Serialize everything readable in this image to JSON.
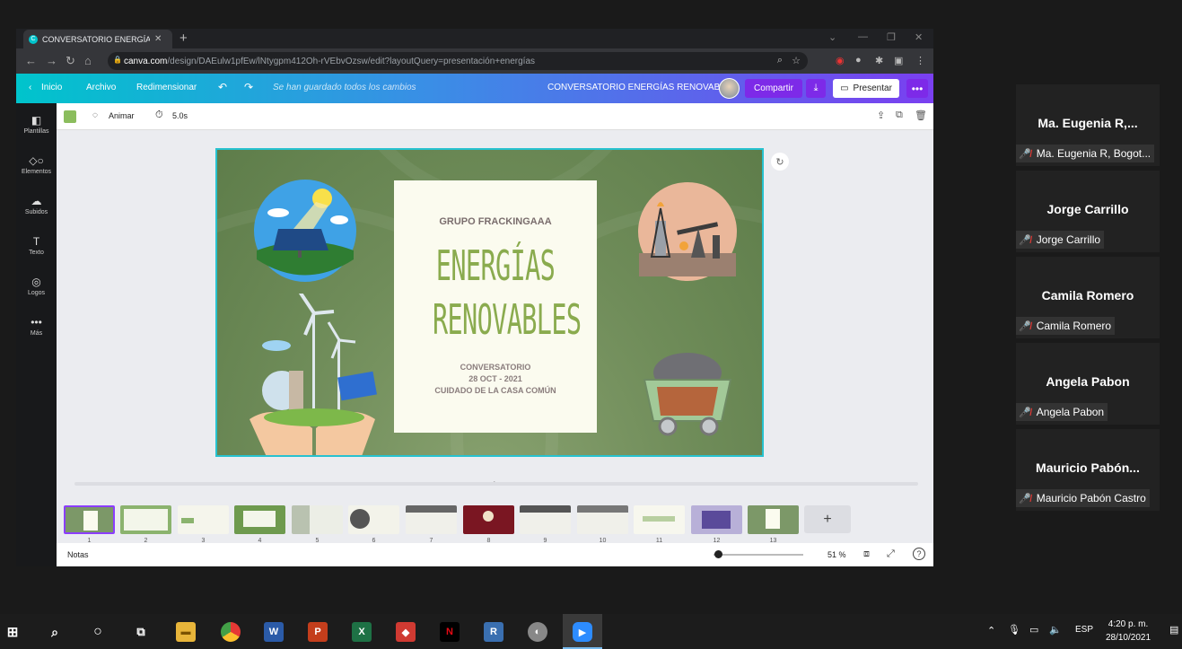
{
  "browser": {
    "tab_title": "CONVERSATORIO ENERGÍAS RENO",
    "url_domain": "canva.com",
    "url_rest": "/design/DAEulw1pfEw/lNtygpm412Oh-rVEbvOzsw/edit?layoutQuery=presentación+energías"
  },
  "canva": {
    "header": {
      "home": "Inicio",
      "file": "Archivo",
      "resize": "Redimensionar",
      "saved_status": "Se han guardado todos los cambios",
      "design_title": "CONVERSATORIO ENERGÍAS RENOVABLES",
      "share": "Compartir",
      "present": "Presentar"
    },
    "rail": [
      {
        "label": "Plantillas",
        "icon": "templates-icon"
      },
      {
        "label": "Elementos",
        "icon": "elements-icon"
      },
      {
        "label": "Subidos",
        "icon": "uploads-icon"
      },
      {
        "label": "Texto",
        "icon": "text-icon"
      },
      {
        "label": "Logos",
        "icon": "logos-icon"
      },
      {
        "label": "Más",
        "icon": "more-icon"
      }
    ],
    "toolbar": {
      "animate": "Animar",
      "duration": "5.0s"
    },
    "slide": {
      "group": "GRUPO FRACKINGAAA",
      "title_line1": "ENERGÍAS",
      "title_line2": "RENOVABLES",
      "sub1": "CONVERSATORIO",
      "sub2": "28 OCT - 2021",
      "sub3": "CUIDADO DE LA CASA COMÚN"
    },
    "pages": [
      "1",
      "2",
      "3",
      "4",
      "5",
      "6",
      "7",
      "8",
      "9",
      "10",
      "11",
      "12",
      "13"
    ],
    "notes": "Notas",
    "zoom": "51 %",
    "zoom_fraction": 0.05,
    "colors": {
      "accent": "#7d2ae8",
      "slide_green": "#6f8c59",
      "title_green": "#8aab4e"
    }
  },
  "participants": [
    {
      "tile_name": "Ma.  Eugenia R,...",
      "label": "Ma. Eugenia R, Bogot..."
    },
    {
      "tile_name": "Jorge Carrillo",
      "label": "Jorge Carrillo"
    },
    {
      "tile_name": "Camila Romero",
      "label": "Camila Romero"
    },
    {
      "tile_name": "Angela Pabon",
      "label": "Angela Pabon"
    },
    {
      "tile_name": "Mauricio  Pabón...",
      "label": "Mauricio Pabón Castro"
    }
  ],
  "taskbar": {
    "lang": "ESP",
    "time": "4:20 p. m.",
    "date": "28/10/2021"
  }
}
